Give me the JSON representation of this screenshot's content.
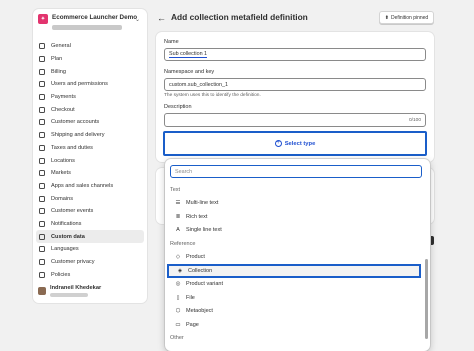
{
  "sidebar": {
    "store_name": "Ecommerce Launcher Demo",
    "items": [
      {
        "label": "General",
        "active": false
      },
      {
        "label": "Plan",
        "active": false
      },
      {
        "label": "Billing",
        "active": false
      },
      {
        "label": "Users and permissions",
        "active": false
      },
      {
        "label": "Payments",
        "active": false
      },
      {
        "label": "Checkout",
        "active": false
      },
      {
        "label": "Customer accounts",
        "active": false
      },
      {
        "label": "Shipping and delivery",
        "active": false
      },
      {
        "label": "Taxes and duties",
        "active": false
      },
      {
        "label": "Locations",
        "active": false
      },
      {
        "label": "Markets",
        "active": false
      },
      {
        "label": "Apps and sales channels",
        "active": false
      },
      {
        "label": "Domains",
        "active": false
      },
      {
        "label": "Customer events",
        "active": false
      },
      {
        "label": "Notifications",
        "active": false
      },
      {
        "label": "Custom data",
        "active": true
      },
      {
        "label": "Languages",
        "active": false
      },
      {
        "label": "Customer privacy",
        "active": false
      },
      {
        "label": "Policies",
        "active": false
      }
    ],
    "user_name": "Indraneil Khedekar"
  },
  "header": {
    "title": "Add collection metafield definition",
    "pinned_label": "Definition pinned"
  },
  "form": {
    "name_label": "Name",
    "name_value": "Sub collection 1",
    "namespace_label": "Namespace and key",
    "namespace_value": "custom.sub_collection_1",
    "namespace_help": "The system uses this to identify the definition.",
    "description_label": "Description",
    "description_counter": "0/100",
    "select_type_label": "Select type"
  },
  "dropdown": {
    "search_placeholder": "Search",
    "groups": [
      {
        "label": "Text",
        "items": [
          {
            "label": "Multi-line text",
            "icon": "multiline-icon",
            "glyph": "☰"
          },
          {
            "label": "Rich text",
            "icon": "richtext-icon",
            "glyph": "≣"
          },
          {
            "label": "Single line text",
            "icon": "text-icon",
            "glyph": "A"
          }
        ]
      },
      {
        "label": "Reference",
        "items": [
          {
            "label": "Product",
            "icon": "tag-icon",
            "glyph": "◇"
          },
          {
            "label": "Collection",
            "icon": "collection-icon",
            "glyph": "◈",
            "highlighted": true
          },
          {
            "label": "Product variant",
            "icon": "variant-icon",
            "glyph": "◎"
          },
          {
            "label": "File",
            "icon": "file-icon",
            "glyph": "▯"
          },
          {
            "label": "Metaobject",
            "icon": "metaobject-icon",
            "glyph": "⬡"
          },
          {
            "label": "Page",
            "icon": "page-icon",
            "glyph": "▭"
          }
        ]
      },
      {
        "label": "Other",
        "items": []
      }
    ]
  }
}
